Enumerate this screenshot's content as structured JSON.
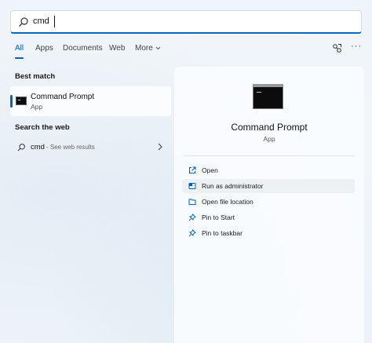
{
  "search": {
    "value": "cmd"
  },
  "tabs": [
    {
      "label": "All",
      "active": true
    },
    {
      "label": "Apps",
      "active": false
    },
    {
      "label": "Documents",
      "active": false
    },
    {
      "label": "Web",
      "active": false
    },
    {
      "label": "More",
      "active": false
    }
  ],
  "best_match": {
    "heading": "Best match",
    "title": "Command Prompt",
    "subtitle": "App"
  },
  "search_web": {
    "heading": "Search the web",
    "query": "cmd",
    "hint": "- See web results"
  },
  "detail": {
    "title": "Command Prompt",
    "subtitle": "App",
    "actions": [
      {
        "label": "Open",
        "icon": "open-external-icon"
      },
      {
        "label": "Run as administrator",
        "icon": "shield-admin-icon"
      },
      {
        "label": "Open file location",
        "icon": "folder-icon"
      },
      {
        "label": "Pin to Start",
        "icon": "pin-icon"
      },
      {
        "label": "Pin to taskbar",
        "icon": "pin-icon"
      }
    ]
  },
  "colors": {
    "accent": "#0067c0",
    "icon_blue": "#005fb8"
  }
}
